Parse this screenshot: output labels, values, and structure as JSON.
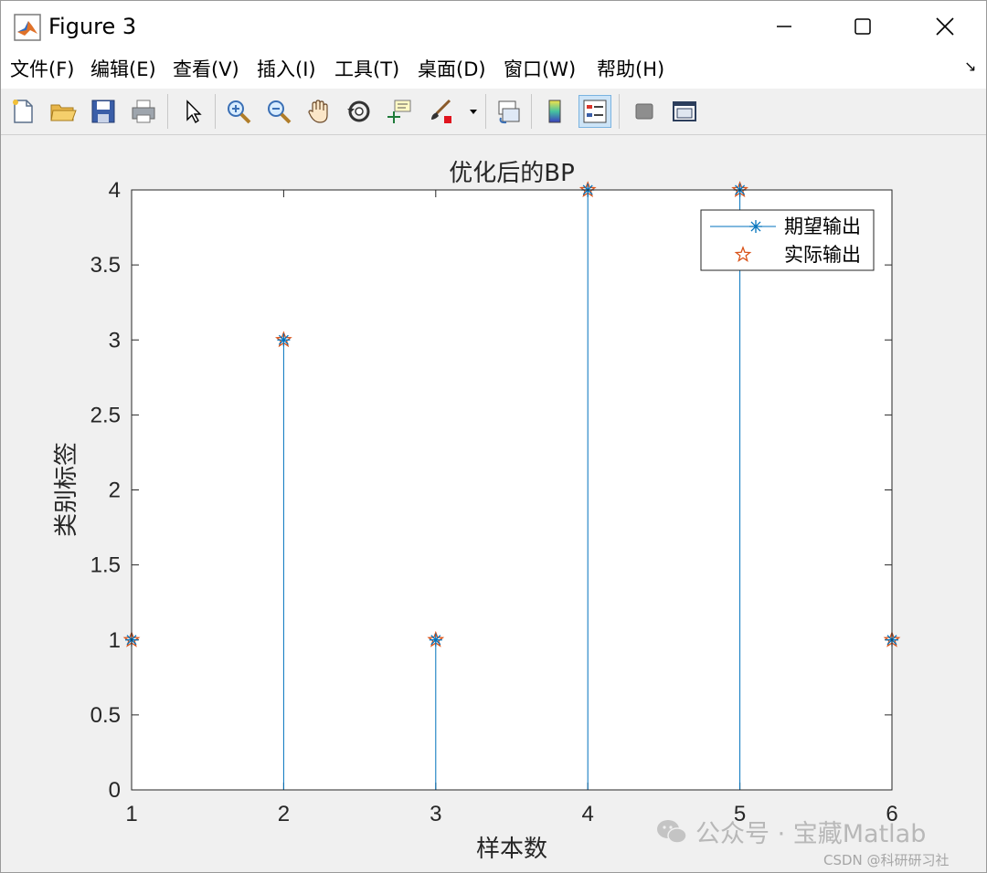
{
  "window": {
    "title": "Figure 3",
    "icon": "matlab-logo-icon",
    "controls": {
      "minimize": "minimize-icon",
      "maximize": "maximize-icon",
      "close": "close-icon"
    }
  },
  "menu": {
    "items": [
      "文件(F)",
      "编辑(E)",
      "查看(V)",
      "插入(I)",
      "工具(T)",
      "桌面(D)",
      "窗口(W)",
      "帮助(H)"
    ],
    "overflow_icon": "dock-arrow-icon"
  },
  "toolbar": {
    "buttons": [
      "new-figure-icon",
      "open-file-icon",
      "save-icon",
      "print-icon",
      "edit-plot-pointer-icon",
      "zoom-in-icon",
      "zoom-out-icon",
      "pan-hand-icon",
      "rotate-3d-icon",
      "data-cursor-icon",
      "brush-icon",
      "brush-dropdown-icon",
      "link-plot-icon",
      "colorbar-icon",
      "legend-icon",
      "hide-plot-tools-icon",
      "show-plot-tools-icon"
    ],
    "active": "legend-icon"
  },
  "chart_data": {
    "type": "stem",
    "title": "优化后的BP",
    "xlabel": "样本数",
    "ylabel": "类别标签",
    "x": [
      1,
      2,
      3,
      4,
      5,
      6
    ],
    "series": [
      {
        "name": "期望输出",
        "values": [
          1,
          3,
          1,
          4,
          4,
          1
        ],
        "marker": "asterisk",
        "color": "#0072BD",
        "style": "stem"
      },
      {
        "name": "实际输出",
        "values": [
          1,
          3,
          1,
          4,
          4,
          1
        ],
        "marker": "pentagram",
        "color": "#D95319",
        "style": "markers"
      }
    ],
    "xlim": [
      1,
      6
    ],
    "ylim": [
      0,
      4
    ],
    "xticks": [
      "1",
      "2",
      "3",
      "4",
      "5",
      "6"
    ],
    "yticks": [
      "0",
      "0.5",
      "1",
      "1.5",
      "2",
      "2.5",
      "3",
      "3.5",
      "4"
    ],
    "grid": false,
    "legend": "top-right"
  },
  "watermark": {
    "main": "公众号 · 宝藏Matlab",
    "icon": "wechat-icon",
    "sub": "CSDN @科研研习社"
  }
}
